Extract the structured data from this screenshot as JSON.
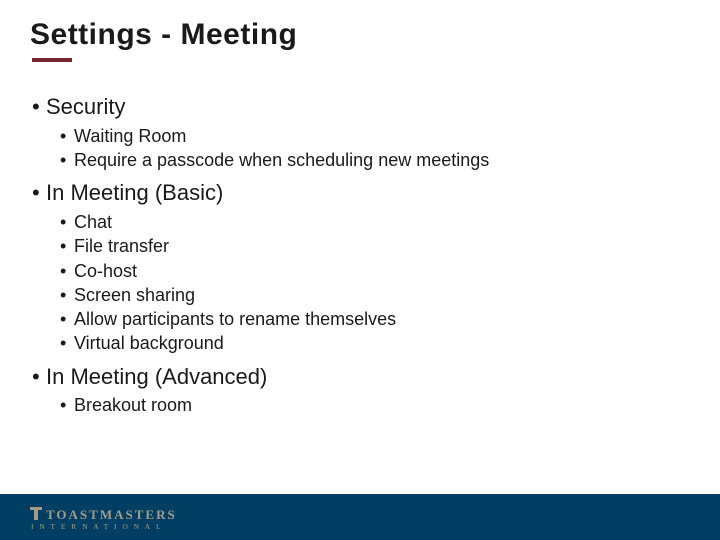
{
  "title": "Settings - Meeting",
  "sections": [
    {
      "label": "Security",
      "items": [
        "Waiting Room",
        "Require a passcode when scheduling new meetings"
      ]
    },
    {
      "label": "In Meeting (Basic)",
      "items": [
        "Chat",
        "File transfer",
        "Co-host",
        "Screen sharing",
        "Allow participants to rename themselves",
        "Virtual background"
      ]
    },
    {
      "label": "In Meeting (Advanced)",
      "items": [
        "Breakout room"
      ]
    }
  ],
  "brand": {
    "top": "TOASTMASTERS",
    "bottom": "INTERNATIONAL"
  }
}
